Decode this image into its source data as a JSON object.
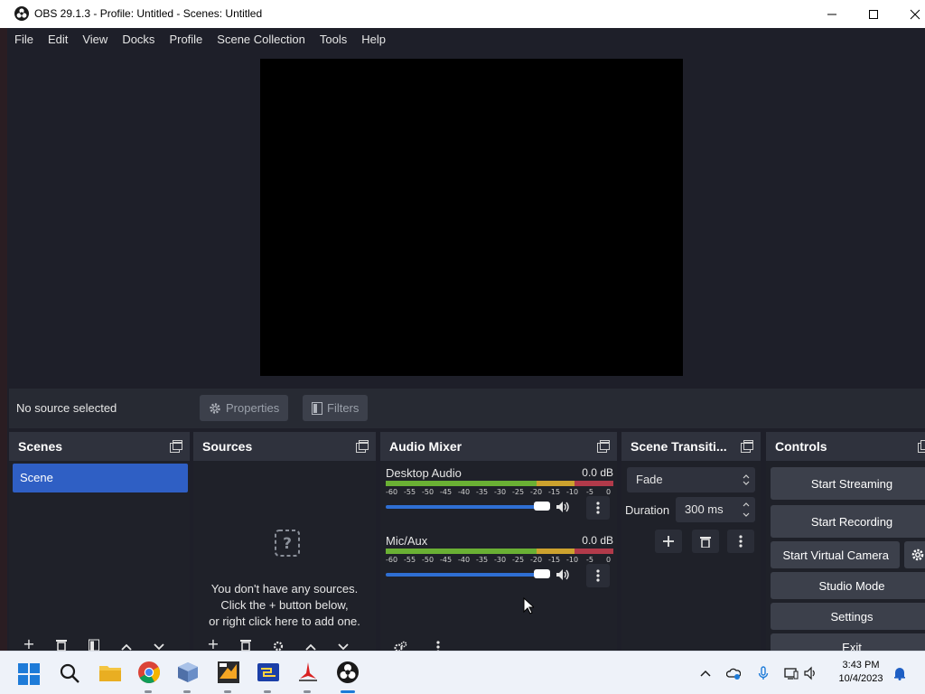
{
  "window": {
    "title": "OBS 29.1.3 - Profile: Untitled - Scenes: Untitled"
  },
  "menu": [
    "File",
    "Edit",
    "View",
    "Docks",
    "Profile",
    "Scene Collection",
    "Tools",
    "Help"
  ],
  "source_toolbar": {
    "status": "No source selected",
    "properties": "Properties",
    "filters": "Filters"
  },
  "docks": {
    "scenes": {
      "title": "Scenes",
      "items": [
        "Scene"
      ]
    },
    "sources": {
      "title": "Sources",
      "empty_line1": "You don't have any sources.",
      "empty_line2": "Click the + button below,",
      "empty_line3": "or right click here to add one."
    },
    "audio_mixer": {
      "title": "Audio Mixer",
      "channels": [
        {
          "name": "Desktop Audio",
          "db": "0.0 dB"
        },
        {
          "name": "Mic/Aux",
          "db": "0.0 dB"
        }
      ],
      "ticks": [
        "-60",
        "-55",
        "-50",
        "-45",
        "-40",
        "-35",
        "-30",
        "-25",
        "-20",
        "-15",
        "-10",
        "-5",
        "0"
      ]
    },
    "transitions": {
      "title": "Scene Transiti...",
      "selected": "Fade",
      "duration_label": "Duration",
      "duration_value": "300 ms"
    },
    "controls": {
      "title": "Controls",
      "start_streaming": "Start Streaming",
      "start_recording": "Start Recording",
      "start_virtual_camera": "Start Virtual Camera",
      "studio_mode": "Studio Mode",
      "settings": "Settings",
      "exit": "Exit"
    }
  },
  "taskbar": {
    "time": "3:43 PM",
    "date": "10/4/2023"
  },
  "colors": {
    "accent": "#2f5fc4",
    "panel": "#272a33",
    "background": "#1e1f29"
  }
}
